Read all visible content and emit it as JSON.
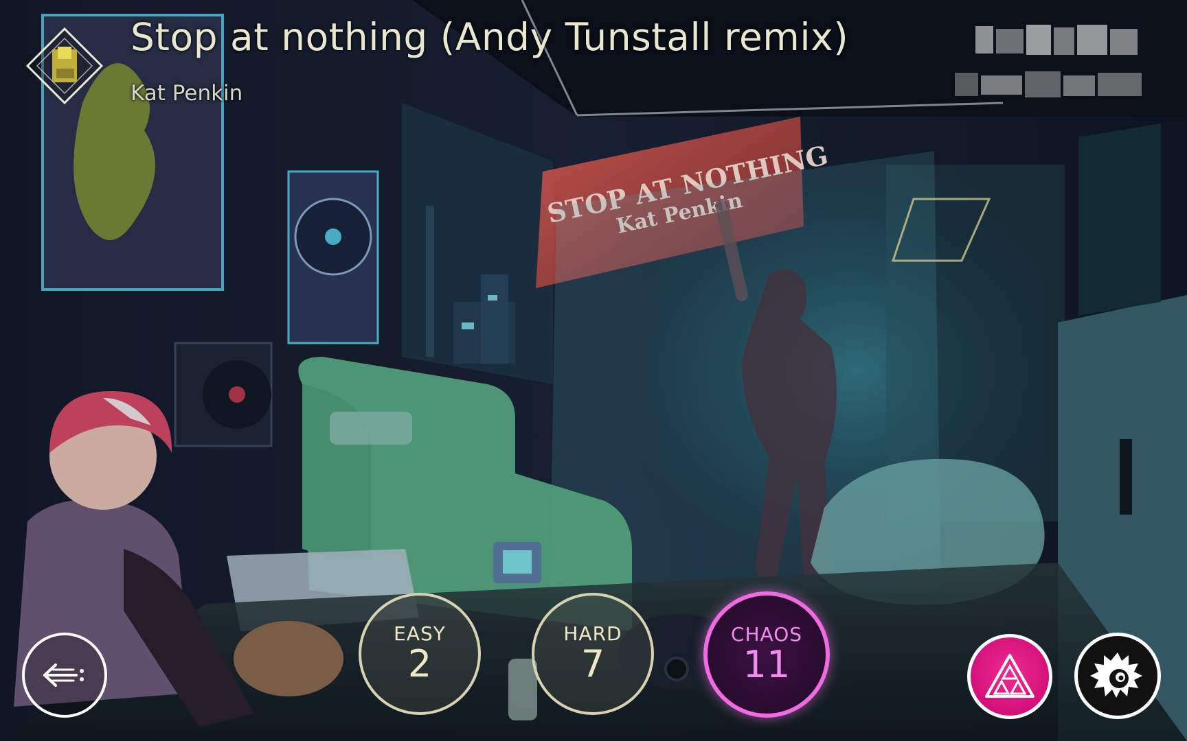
{
  "song": {
    "title": "Stop at nothing (Andy Tunstall remix)",
    "artist": "Kat Penkin"
  },
  "artwork": {
    "sign_line1": "STOP AT NOTHING",
    "sign_line2": "Kat Penkin"
  },
  "difficulties": [
    {
      "name": "EASY",
      "level": "2"
    },
    {
      "name": "HARD",
      "level": "7"
    },
    {
      "name": "CHAOS",
      "level": "11",
      "selected": true
    }
  ],
  "colors": {
    "chaos_accent": "#f06ae2",
    "mode_button": "#e0188a",
    "hud_text": "#e9e6d2",
    "ring": "#d8d1b2"
  },
  "icons": {
    "back": "back-arrow-icon",
    "mode": "triforce-triangle-icon",
    "character": "cherry-character-icon",
    "song": "song-diamond-icon"
  }
}
